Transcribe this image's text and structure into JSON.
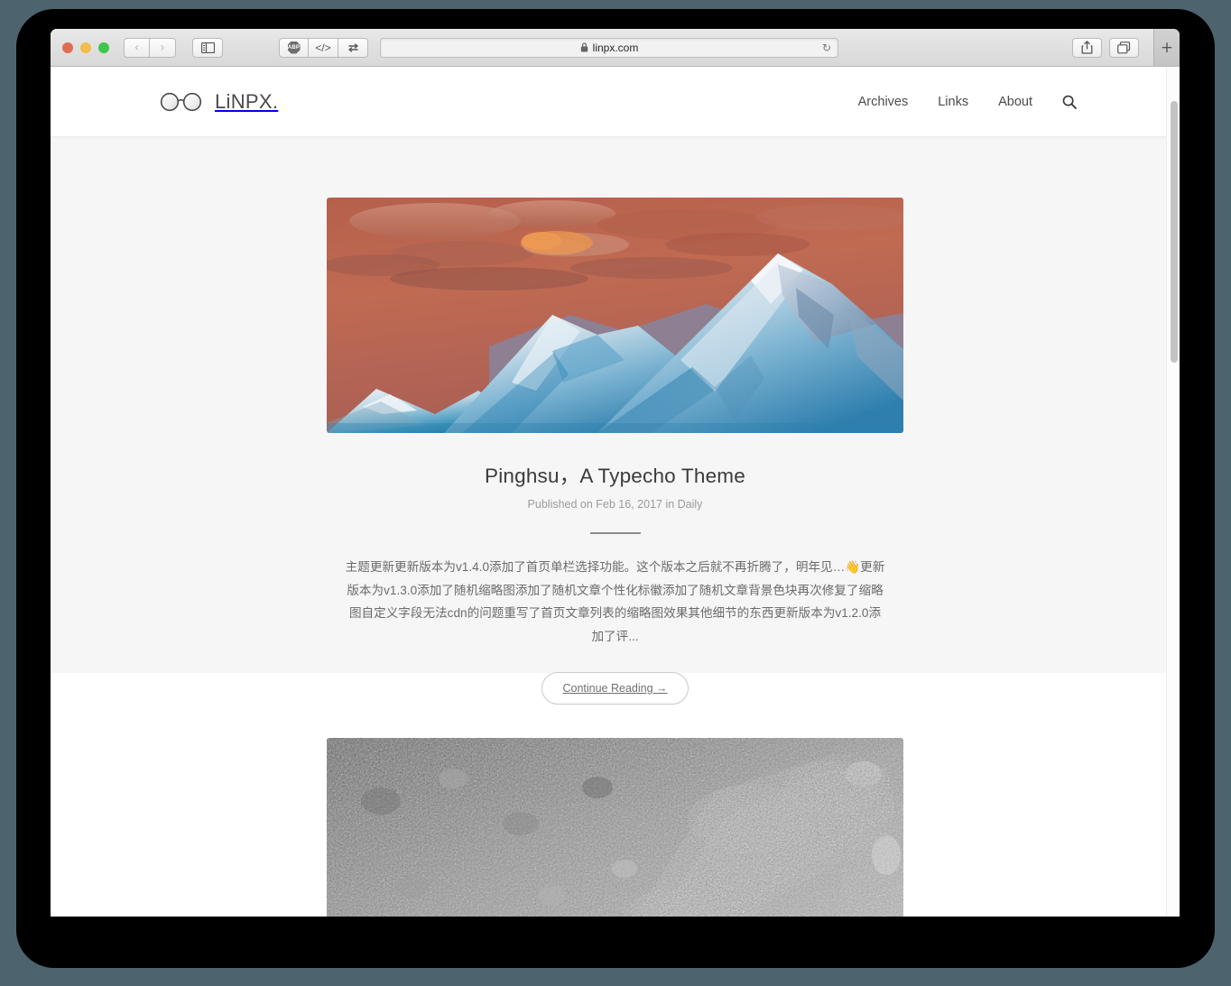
{
  "browser": {
    "traffic_lights": [
      {
        "name": "close",
        "color": "#e06c51"
      },
      {
        "name": "minimize",
        "color": "#f2bd4c"
      },
      {
        "name": "zoom",
        "color": "#3fc54b"
      }
    ],
    "back_label": "‹",
    "forward_label": "›",
    "sidebar_icon": "sidebar-icon",
    "extensions": [
      {
        "name": "adblock-plus",
        "label": "ABP"
      },
      {
        "name": "developer",
        "label": "</>"
      },
      {
        "name": "sync-arrows",
        "label": "⇄"
      }
    ],
    "url": "linpx.com",
    "lock_icon": "🔒",
    "reload_label": "↻",
    "share_icon": "share-icon",
    "tabs_icon": "tab-overview-icon",
    "new_tab_label": "+"
  },
  "site": {
    "brand": "LiNPX.",
    "logo_icon": "glasses-logo",
    "nav": [
      {
        "label": "Archives"
      },
      {
        "label": "Links"
      },
      {
        "label": "About"
      }
    ],
    "search_icon": "search-icon"
  },
  "posts": [
    {
      "thumb_alt": "snow-capped-mountain-at-sunset",
      "title": "Pinghsu，A Typecho Theme",
      "meta": "Published on Feb 16, 2017 in Daily",
      "excerpt": "主题更新更新版本为v1.4.0添加了首页单栏选择功能。这个版本之后就不再折腾了，明年见…👋更新版本为v1.3.0添加了随机缩略图添加了随机文章个性化标徽添加了随机文章背景色块再次修复了缩略图自定义字段无法cdn的问题重写了首页文章列表的缩略图效果其他细节的东西更新版本为v1.2.0添加了评...",
      "continue_label": "Continue Reading →"
    },
    {
      "thumb_alt": "gray-gravel-with-red-lichen"
    }
  ],
  "colors": {
    "page_bg": "#ffffff",
    "section_bg": "#f6f6f6",
    "text": "#3b3b3b",
    "muted": "#9b9b9b",
    "desktop": "#4d646e"
  }
}
